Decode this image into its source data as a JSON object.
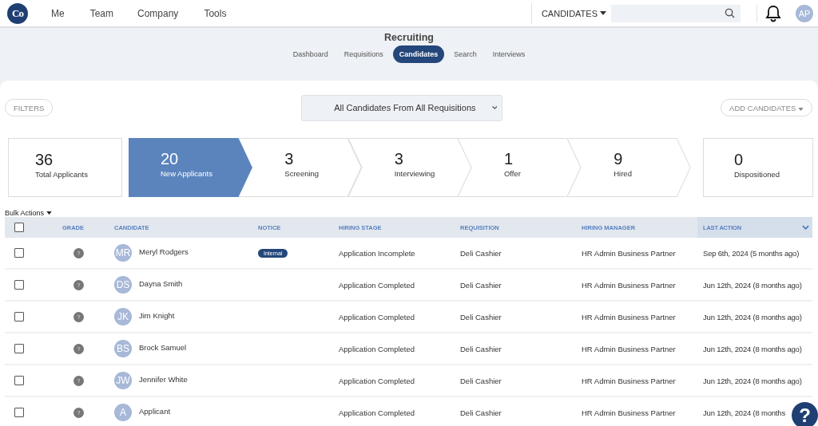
{
  "logo": {
    "text": "Co"
  },
  "nav": [
    {
      "label": "Me"
    },
    {
      "label": "Team"
    },
    {
      "label": "Company"
    },
    {
      "label": "Tools"
    }
  ],
  "search": {
    "scope": "CANDIDATES"
  },
  "user": {
    "initials": "AP"
  },
  "section": {
    "title": "Recruiting"
  },
  "tabs": [
    {
      "label": "Dashboard",
      "selected": false
    },
    {
      "label": "Requisitions",
      "selected": false
    },
    {
      "label": "Candidates",
      "selected": true
    },
    {
      "label": "Search",
      "selected": false
    },
    {
      "label": "Interviews",
      "selected": false
    }
  ],
  "filters_button": "FILTERS",
  "requisition_select": {
    "value": "All Candidates From All Requisitions"
  },
  "add_button": "ADD CANDIDATES",
  "total": {
    "count": "36",
    "label": "Total Applicants"
  },
  "stages": [
    {
      "count": "20",
      "label": "New Applicants",
      "selected": true
    },
    {
      "count": "3",
      "label": "Screening",
      "selected": false
    },
    {
      "count": "3",
      "label": "Interviewing",
      "selected": false
    },
    {
      "count": "1",
      "label": "Offer",
      "selected": false
    },
    {
      "count": "9",
      "label": "Hired",
      "selected": false
    }
  ],
  "dispositioned": {
    "count": "0",
    "label": "Dispositioned"
  },
  "bulk_actions": "Bulk Actions",
  "table": {
    "select_all": {
      "checked": false
    },
    "columns": [
      {
        "label": "GRADE",
        "sorted": false
      },
      {
        "label": "CANDIDATE",
        "sorted": false
      },
      {
        "label": "NOTICE",
        "sorted": false
      },
      {
        "label": "HIRING STAGE",
        "sorted": false
      },
      {
        "label": "REQUISITION",
        "sorted": false
      },
      {
        "label": "HIRING MANAGER",
        "sorted": false
      },
      {
        "label": "LAST ACTION",
        "sorted": true
      }
    ],
    "rows": [
      {
        "checked": false,
        "grade": "?",
        "initials": "MR",
        "name": "Meryl Rodgers",
        "notice": "Internal",
        "stage": "Application Incomplete",
        "requisition": "Deli Cashier",
        "manager": "HR Admin Business Partner",
        "last_action": "Sep 6th, 2024 (5 months ago)"
      },
      {
        "checked": false,
        "grade": "?",
        "initials": "DS",
        "name": "Dayna Smith",
        "stage": "Application Completed",
        "requisition": "Deli Cashier",
        "manager": "HR Admin Business Partner",
        "last_action": "Jun 12th, 2024 (8 months ago)"
      },
      {
        "checked": false,
        "grade": "?",
        "initials": "JK",
        "name": "Jim Knight",
        "stage": "Application Completed",
        "requisition": "Deli Cashier",
        "manager": "HR Admin Business Partner",
        "last_action": "Jun 12th, 2024 (8 months ago)"
      },
      {
        "checked": false,
        "grade": "?",
        "initials": "BS",
        "name": "Brock Samuel",
        "stage": "Application Completed",
        "requisition": "Deli Cashier",
        "manager": "HR Admin Business Partner",
        "last_action": "Jun 12th, 2024 (8 months ago)"
      },
      {
        "checked": false,
        "grade": "?",
        "initials": "JW",
        "name": "Jennifer White",
        "stage": "Application Completed",
        "requisition": "Deli Cashier",
        "manager": "HR Admin Business Partner",
        "last_action": "Jun 12th, 2024 (8 months ago)"
      },
      {
        "checked": false,
        "grade": "?",
        "initials": "A",
        "name": "Applicant",
        "stage": "Application Completed",
        "requisition": "Deli Cashier",
        "manager": "HR Admin Business Partner",
        "last_action": "Jun 12th, 2024 (8 months"
      }
    ]
  },
  "help_button": "?"
}
